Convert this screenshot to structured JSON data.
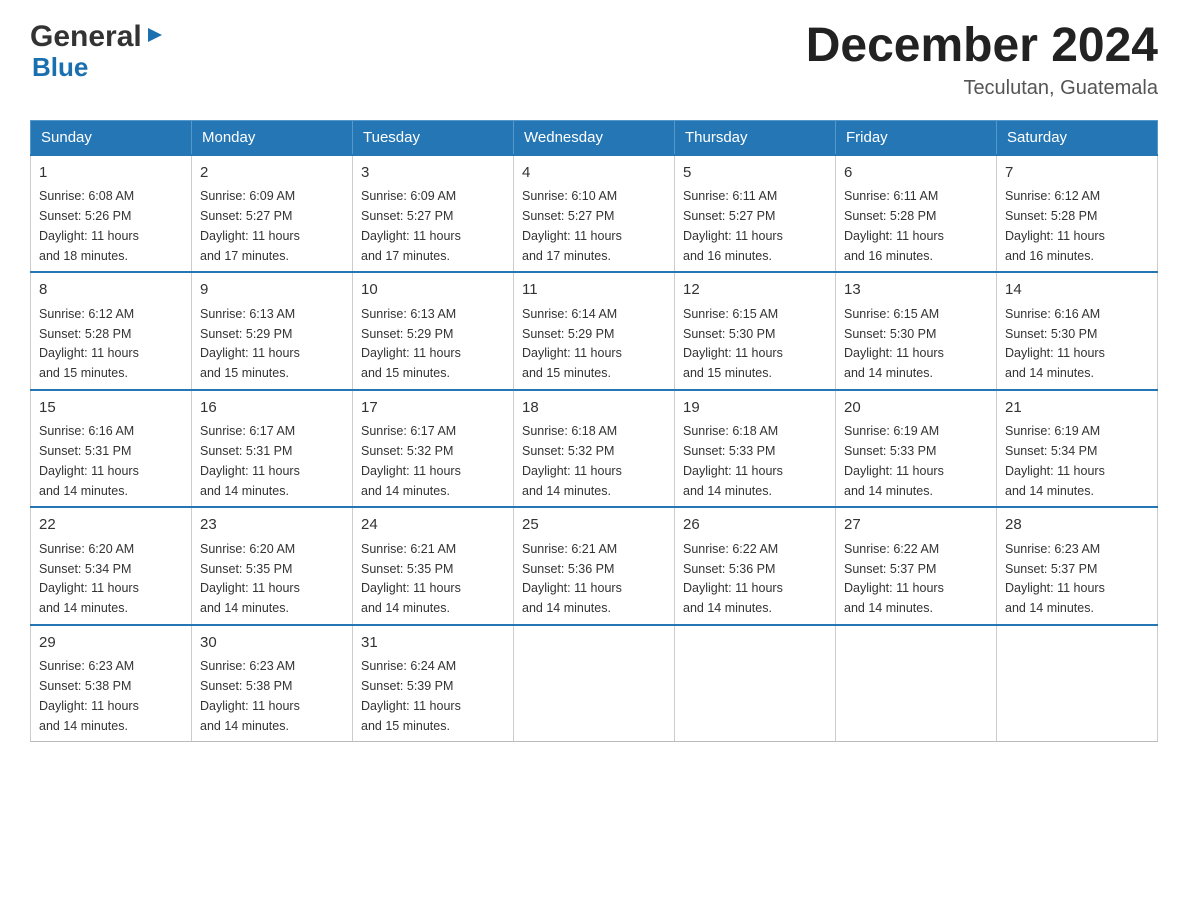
{
  "header": {
    "logo": {
      "general": "General",
      "blue": "Blue",
      "arrow_unicode": "▶"
    },
    "title": "December 2024",
    "location": "Teculutan, Guatemala"
  },
  "calendar": {
    "days_of_week": [
      "Sunday",
      "Monday",
      "Tuesday",
      "Wednesday",
      "Thursday",
      "Friday",
      "Saturday"
    ],
    "weeks": [
      [
        {
          "day": "1",
          "sunrise": "6:08 AM",
          "sunset": "5:26 PM",
          "daylight": "11 hours and 18 minutes."
        },
        {
          "day": "2",
          "sunrise": "6:09 AM",
          "sunset": "5:27 PM",
          "daylight": "11 hours and 17 minutes."
        },
        {
          "day": "3",
          "sunrise": "6:09 AM",
          "sunset": "5:27 PM",
          "daylight": "11 hours and 17 minutes."
        },
        {
          "day": "4",
          "sunrise": "6:10 AM",
          "sunset": "5:27 PM",
          "daylight": "11 hours and 17 minutes."
        },
        {
          "day": "5",
          "sunrise": "6:11 AM",
          "sunset": "5:27 PM",
          "daylight": "11 hours and 16 minutes."
        },
        {
          "day": "6",
          "sunrise": "6:11 AM",
          "sunset": "5:28 PM",
          "daylight": "11 hours and 16 minutes."
        },
        {
          "day": "7",
          "sunrise": "6:12 AM",
          "sunset": "5:28 PM",
          "daylight": "11 hours and 16 minutes."
        }
      ],
      [
        {
          "day": "8",
          "sunrise": "6:12 AM",
          "sunset": "5:28 PM",
          "daylight": "11 hours and 15 minutes."
        },
        {
          "day": "9",
          "sunrise": "6:13 AM",
          "sunset": "5:29 PM",
          "daylight": "11 hours and 15 minutes."
        },
        {
          "day": "10",
          "sunrise": "6:13 AM",
          "sunset": "5:29 PM",
          "daylight": "11 hours and 15 minutes."
        },
        {
          "day": "11",
          "sunrise": "6:14 AM",
          "sunset": "5:29 PM",
          "daylight": "11 hours and 15 minutes."
        },
        {
          "day": "12",
          "sunrise": "6:15 AM",
          "sunset": "5:30 PM",
          "daylight": "11 hours and 15 minutes."
        },
        {
          "day": "13",
          "sunrise": "6:15 AM",
          "sunset": "5:30 PM",
          "daylight": "11 hours and 14 minutes."
        },
        {
          "day": "14",
          "sunrise": "6:16 AM",
          "sunset": "5:30 PM",
          "daylight": "11 hours and 14 minutes."
        }
      ],
      [
        {
          "day": "15",
          "sunrise": "6:16 AM",
          "sunset": "5:31 PM",
          "daylight": "11 hours and 14 minutes."
        },
        {
          "day": "16",
          "sunrise": "6:17 AM",
          "sunset": "5:31 PM",
          "daylight": "11 hours and 14 minutes."
        },
        {
          "day": "17",
          "sunrise": "6:17 AM",
          "sunset": "5:32 PM",
          "daylight": "11 hours and 14 minutes."
        },
        {
          "day": "18",
          "sunrise": "6:18 AM",
          "sunset": "5:32 PM",
          "daylight": "11 hours and 14 minutes."
        },
        {
          "day": "19",
          "sunrise": "6:18 AM",
          "sunset": "5:33 PM",
          "daylight": "11 hours and 14 minutes."
        },
        {
          "day": "20",
          "sunrise": "6:19 AM",
          "sunset": "5:33 PM",
          "daylight": "11 hours and 14 minutes."
        },
        {
          "day": "21",
          "sunrise": "6:19 AM",
          "sunset": "5:34 PM",
          "daylight": "11 hours and 14 minutes."
        }
      ],
      [
        {
          "day": "22",
          "sunrise": "6:20 AM",
          "sunset": "5:34 PM",
          "daylight": "11 hours and 14 minutes."
        },
        {
          "day": "23",
          "sunrise": "6:20 AM",
          "sunset": "5:35 PM",
          "daylight": "11 hours and 14 minutes."
        },
        {
          "day": "24",
          "sunrise": "6:21 AM",
          "sunset": "5:35 PM",
          "daylight": "11 hours and 14 minutes."
        },
        {
          "day": "25",
          "sunrise": "6:21 AM",
          "sunset": "5:36 PM",
          "daylight": "11 hours and 14 minutes."
        },
        {
          "day": "26",
          "sunrise": "6:22 AM",
          "sunset": "5:36 PM",
          "daylight": "11 hours and 14 minutes."
        },
        {
          "day": "27",
          "sunrise": "6:22 AM",
          "sunset": "5:37 PM",
          "daylight": "11 hours and 14 minutes."
        },
        {
          "day": "28",
          "sunrise": "6:23 AM",
          "sunset": "5:37 PM",
          "daylight": "11 hours and 14 minutes."
        }
      ],
      [
        {
          "day": "29",
          "sunrise": "6:23 AM",
          "sunset": "5:38 PM",
          "daylight": "11 hours and 14 minutes."
        },
        {
          "day": "30",
          "sunrise": "6:23 AM",
          "sunset": "5:38 PM",
          "daylight": "11 hours and 14 minutes."
        },
        {
          "day": "31",
          "sunrise": "6:24 AM",
          "sunset": "5:39 PM",
          "daylight": "11 hours and 15 minutes."
        },
        null,
        null,
        null,
        null
      ]
    ],
    "labels": {
      "sunrise": "Sunrise:",
      "sunset": "Sunset:",
      "daylight": "Daylight:"
    }
  }
}
